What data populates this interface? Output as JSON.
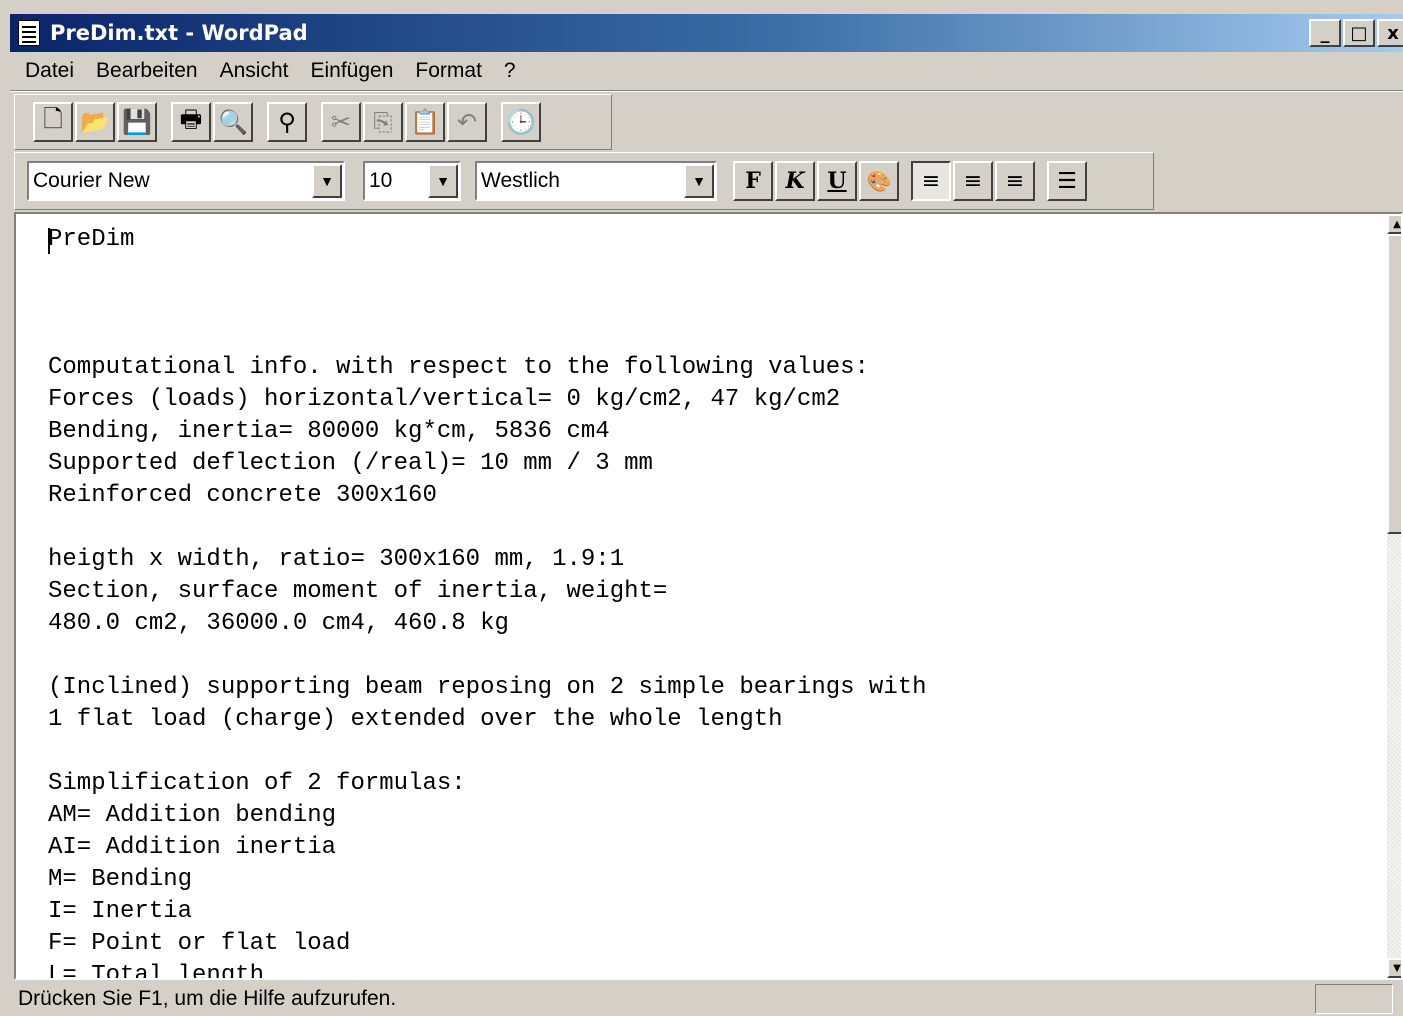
{
  "window": {
    "title": "PreDim.txt - WordPad",
    "minimize": "_",
    "maximize": "□",
    "close": "x"
  },
  "menu": [
    "Datei",
    "Bearbeiten",
    "Ansicht",
    "Einfügen",
    "Format",
    "?"
  ],
  "toolbar": {
    "icons": [
      "new-document-icon",
      "open-folder-icon",
      "save-icon",
      "print-icon",
      "print-preview-icon",
      "find-icon",
      "cut-icon",
      "copy-icon",
      "paste-icon",
      "undo-icon",
      "insert-datetime-icon"
    ]
  },
  "format_bar": {
    "font": "Courier New",
    "size": "10",
    "script": "Westlich",
    "bold": "F",
    "italic": "K",
    "underline": "U"
  },
  "document": {
    "lines": [
      "PreDim",
      "",
      "",
      "",
      "Computational info. with respect to the following values:",
      "Forces (loads) horizontal/vertical= 0 kg/cm2, 47 kg/cm2",
      "Bending, inertia= 80000 kg*cm, 5836 cm4",
      "Supported deflection (/real)= 10 mm / 3 mm",
      "Reinforced concrete 300x160",
      "",
      "heigth x width, ratio= 300x160 mm, 1.9:1",
      "Section, surface moment of inertia, weight=",
      "480.0 cm2, 36000.0 cm4, 460.8 kg",
      "",
      "(Inclined) supporting beam reposing on 2 simple bearings with",
      "1 flat load (charge) extended over the whole length",
      "",
      "Simplification of 2 formulas:",
      "AM= Addition bending",
      "AI= Addition inertia",
      "M= Bending",
      "I= Inertia",
      "F= Point or flat load",
      "L= Total length"
    ]
  },
  "status": {
    "text": "Drücken Sie F1, um die Hilfe aufzurufen."
  }
}
